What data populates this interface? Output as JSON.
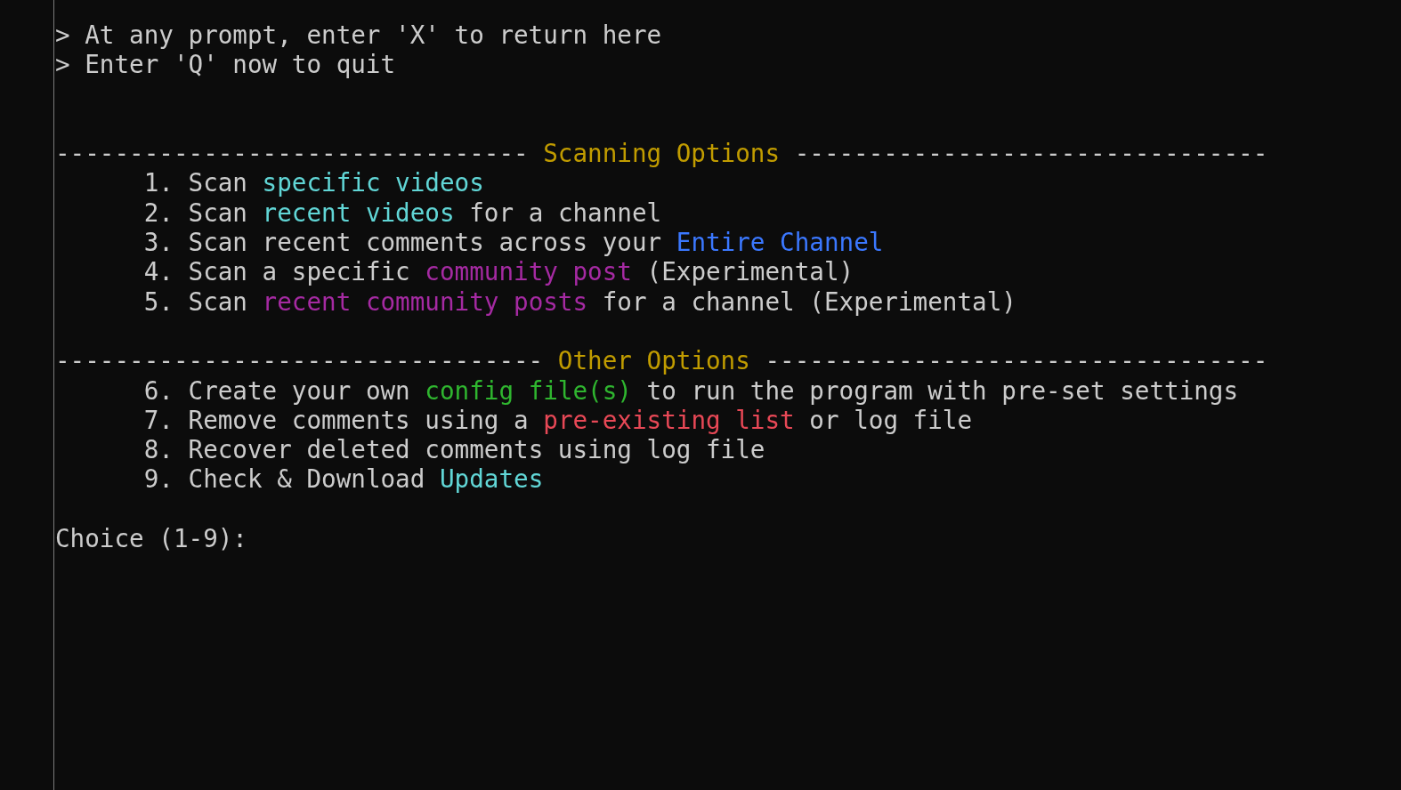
{
  "terminal": {
    "notes": [
      "> At any prompt, enter 'X' to return here",
      "> Enter 'Q' now to quit"
    ],
    "sections": [
      {
        "rule_left": "--------------------------------",
        "title": "Scanning Options",
        "rule_right": "--------------------------------",
        "items": [
          {
            "number": "1.",
            "segments": [
              {
                "text": "Scan"
              },
              {
                "text": "specific videos",
                "color": "#61d6d6"
              }
            ]
          },
          {
            "number": "2.",
            "segments": [
              {
                "text": "Scan"
              },
              {
                "text": "recent videos",
                "color": "#61d6d6"
              },
              {
                "text": "for a channel"
              }
            ]
          },
          {
            "number": "3.",
            "segments": [
              {
                "text": "Scan recent comments across your"
              },
              {
                "text": "Entire Channel",
                "color": "#3b78ff"
              }
            ]
          },
          {
            "number": "4.",
            "segments": [
              {
                "text": "Scan a specific"
              },
              {
                "text": "community post",
                "color": "#a52aa2"
              },
              {
                "text": "(Experimental)"
              }
            ]
          },
          {
            "number": "5.",
            "segments": [
              {
                "text": "Scan"
              },
              {
                "text": "recent community posts",
                "color": "#a52aa2"
              },
              {
                "text": "for a channel (Experimental)"
              }
            ]
          }
        ]
      },
      {
        "rule_left": "---------------------------------",
        "title": "Other Options",
        "rule_right": "----------------------------------",
        "items": [
          {
            "number": "6.",
            "segments": [
              {
                "text": "Create your own"
              },
              {
                "text": "config file(s)",
                "color": "#2fb52f"
              },
              {
                "text": "to run the program with pre-set settings"
              }
            ]
          },
          {
            "number": "7.",
            "segments": [
              {
                "text": "Remove comments using a"
              },
              {
                "text": "pre-existing list",
                "color": "#e74856"
              },
              {
                "text": "or log file"
              }
            ]
          },
          {
            "number": "8.",
            "segments": [
              {
                "text": "Recover deleted comments using log file"
              }
            ]
          },
          {
            "number": "9.",
            "segments": [
              {
                "text": "Check & Download"
              },
              {
                "text": "Updates",
                "color": "#61d6d6"
              }
            ]
          }
        ]
      }
    ],
    "choice_prompt": "Choice (1-9):"
  }
}
